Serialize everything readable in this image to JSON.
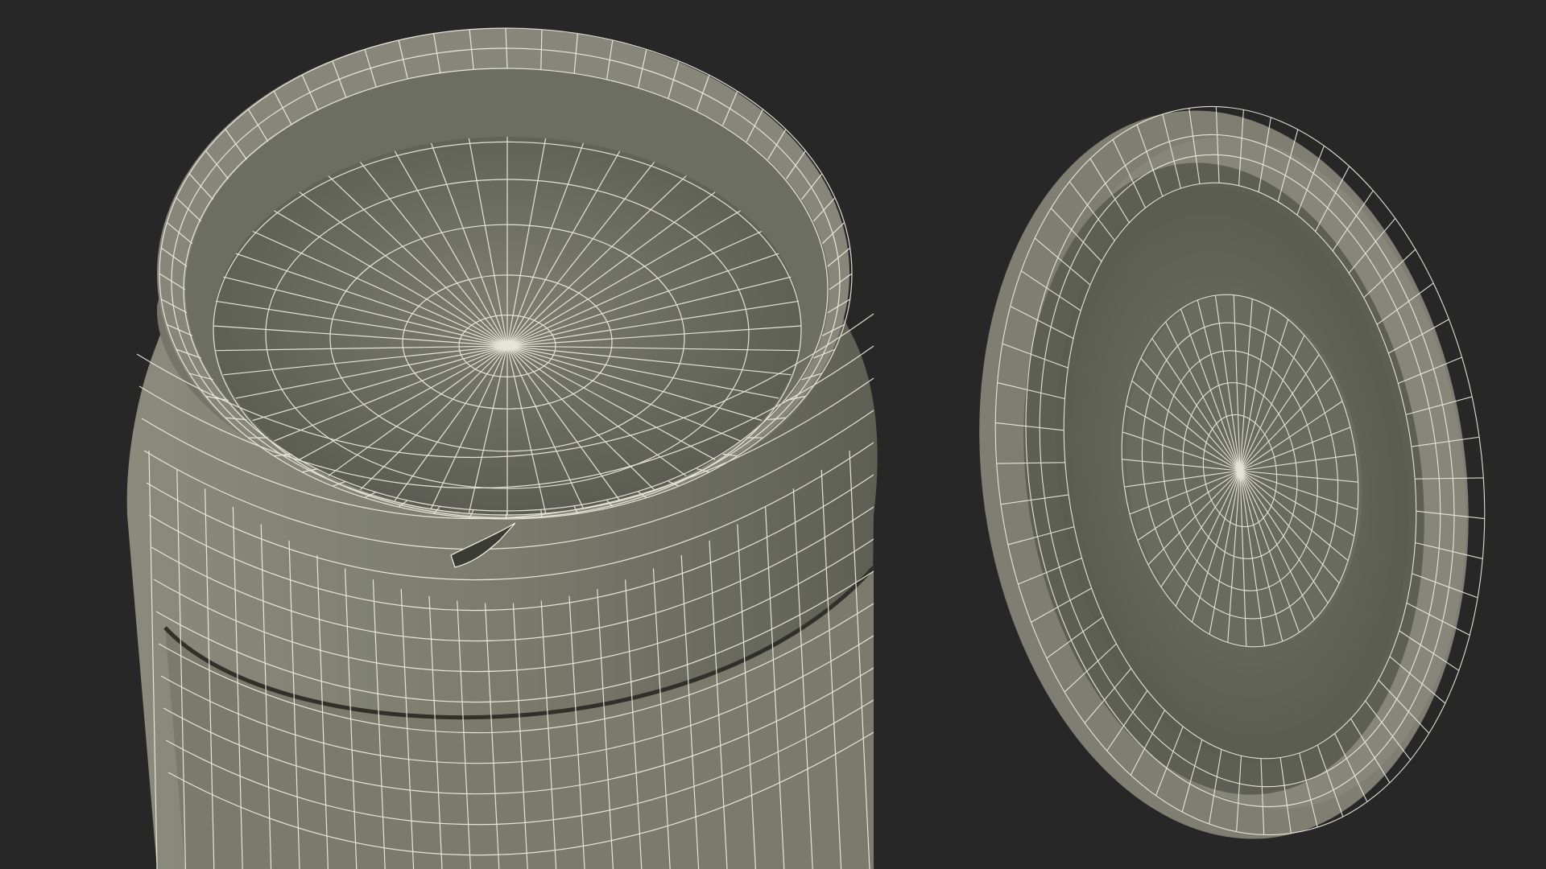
{
  "scene": {
    "background_color": "#272727",
    "surface_color": "#7b7c6e",
    "surface_shadow_color": "#5a5b50",
    "surface_dark_color": "#4a4b42",
    "wire_color": "#f2f1e4",
    "objects": [
      "jar-body",
      "jar-lid"
    ]
  }
}
